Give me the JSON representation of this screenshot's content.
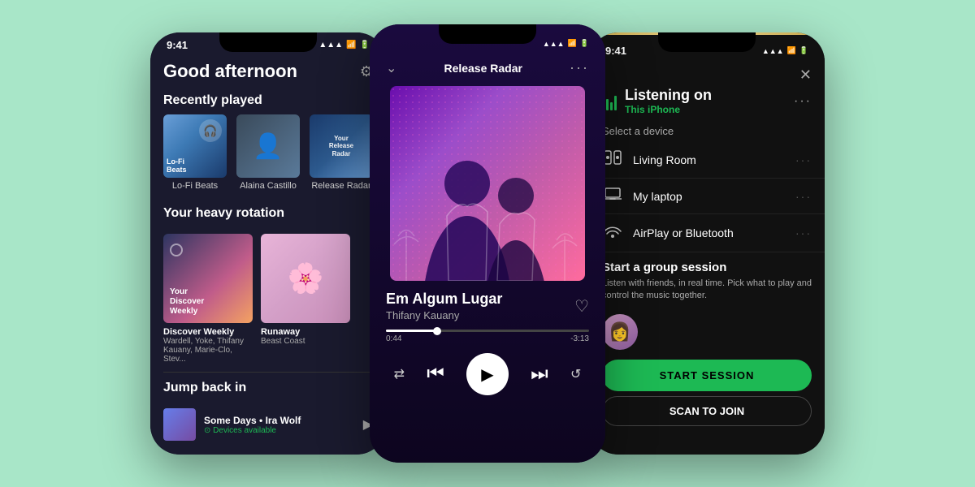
{
  "background_color": "#a8e6c8",
  "left_phone": {
    "status_time": "9:41",
    "header_title": "Good afternoon",
    "settings_icon": "⚙",
    "recently_played_title": "Recently played",
    "recently_played": [
      {
        "label": "Lo-Fi Beats",
        "cover_type": "lofi"
      },
      {
        "label": "Alaina Castillo",
        "cover_type": "person"
      },
      {
        "label": "Release Radar",
        "cover_type": "radar"
      }
    ],
    "heavy_rotation_title": "Your heavy rotation",
    "heavy_rotation": [
      {
        "title": "Discover Weekly",
        "sublabel": "Wardell, Yoke, Thifany Kauany, Marie-Clo, Stev...",
        "cover_type": "dw"
      },
      {
        "title": "Runaway",
        "sublabel": "Beast Coast",
        "cover_type": "runaway"
      }
    ],
    "jump_back_title": "Jump back in",
    "jump_back": [
      {
        "title": "Some Days",
        "sub": "• Ira Wolf",
        "sub2": "⊙ Devices available"
      }
    ]
  },
  "center_phone": {
    "status_time": "",
    "playlist_name": "Release Radar",
    "more_icon": "···",
    "chevron": "⌄",
    "track_title": "Em Algum Lugar",
    "track_artist": "Thifany Kauany",
    "heart_icon": "♡",
    "progress_current": "0:44",
    "progress_total": "-3:13",
    "progress_pct": 25,
    "controls": {
      "shuffle": "⇄",
      "prev": "⏮",
      "play": "▶",
      "next": "⏭",
      "repeat": "↺"
    }
  },
  "right_phone": {
    "status_time": "9:41",
    "close_icon": "✕",
    "listening_title": "Listening on",
    "listening_sub": "This iPhone",
    "more_icon": "···",
    "select_device_label": "Select a device",
    "devices": [
      {
        "name": "Living Room",
        "icon": "speaker",
        "has_dots": true
      },
      {
        "name": "My laptop",
        "icon": "laptop",
        "has_dots": true
      },
      {
        "name": "AirPlay or Bluetooth",
        "icon": "airplay",
        "has_dots": true
      }
    ],
    "group_session_title": "Start a group session",
    "group_session_desc": "Listen with friends, in real time. Pick what to play and control the music together.",
    "start_session_label": "START SESSION",
    "scan_to_join_label": "SCAN TO JOIN"
  }
}
